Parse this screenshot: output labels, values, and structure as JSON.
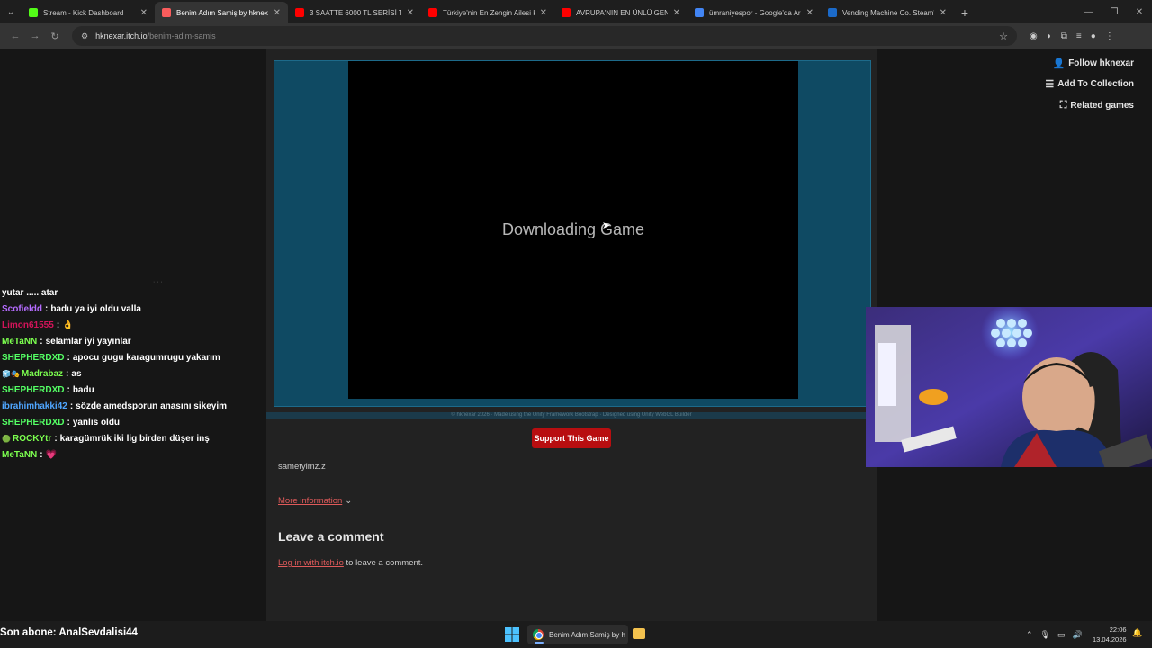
{
  "browser": {
    "tabs": [
      {
        "title": "Stream - Kick Dashboard",
        "favicon_color": "#53fc18",
        "active": false
      },
      {
        "title": "Benim Adım Samiş by hknexar",
        "favicon_color": "#fa5c5c",
        "active": true
      },
      {
        "title": "3 SAATTE 6000 TL SERİSİ TARSU",
        "favicon_color": "#ff0000",
        "active": false
      },
      {
        "title": "Türkiye'nin En Zengin Ailesi Kim",
        "favicon_color": "#ff0000",
        "active": false
      },
      {
        "title": "AVRUPA'NIN EN ÜNLÜ GENELEV",
        "favicon_color": "#ff0000",
        "active": false
      },
      {
        "title": "ümraniyespor - Google'da Ara",
        "favicon_color": "#4285f4",
        "active": false
      },
      {
        "title": "Vending Machine Co. Steam'de",
        "favicon_color": "#1b6ac9",
        "active": false
      }
    ],
    "new_tab_label": "+",
    "url_host": "hknexar.itch.io",
    "url_path": "/benim-adim-samis"
  },
  "game": {
    "loading_text": "Downloading Game",
    "footer_text": "© hknexar 2026 · Made using the Unity Framework Bootstrap · Designed using Unity WebGL Builder",
    "support_label": "Support This Game",
    "author_line": "sametylmz.z",
    "more_info_label": "More information",
    "comment_heading": "Leave a comment",
    "login_link": "Log in with itch.io",
    "login_suffix": " to leave a comment."
  },
  "sidebar": {
    "follow_label": "Follow hknexar",
    "collection_label": "Add To Collection",
    "related_label": "Related games"
  },
  "chat": {
    "messages": [
      {
        "user": "",
        "color": "#ffffff",
        "badge": "",
        "text": "yutar ..... atar"
      },
      {
        "user": "Scofieldd",
        "color": "#b56cff",
        "badge": "",
        "text": "badu ya iyi oldu valla"
      },
      {
        "user": "Limon61555",
        "color": "#d4145a",
        "badge": "",
        "text": "👌"
      },
      {
        "user": "MeTaNN",
        "color": "#7cff4f",
        "badge": "",
        "text": "selamlar iyi yayınlar"
      },
      {
        "user": "SHEPHERDXD",
        "color": "#54ff64",
        "badge": "",
        "text": "apocu gugu karagumrugu yakarım"
      },
      {
        "user": "Madrabaz",
        "color": "#7cff4f",
        "badge": "🧊🎭",
        "text": "as"
      },
      {
        "user": "SHEPHERDXD",
        "color": "#54ff64",
        "badge": "",
        "text": "badu"
      },
      {
        "user": "ibrahimhakki42",
        "color": "#4fa6ff",
        "badge": "",
        "text": "sözde amedsporun anasını sikeyim"
      },
      {
        "user": "SHEPHERDXD",
        "color": "#54ff64",
        "badge": "",
        "text": "yanlıs oldu"
      },
      {
        "user": "ROCKYtr",
        "color": "#7cff4f",
        "badge": "🟢",
        "text": "karagümrük iki lig birden düşer inş"
      },
      {
        "user": "MeTaNN",
        "color": "#7cff4f",
        "badge": "",
        "text": "💗"
      }
    ]
  },
  "stream": {
    "last_sub": "Son abone: AnalSevdalisi44"
  },
  "taskbar": {
    "app_label": "Benim Adım Samiş by h",
    "time": "22:06",
    "date": "13.04.2026"
  }
}
